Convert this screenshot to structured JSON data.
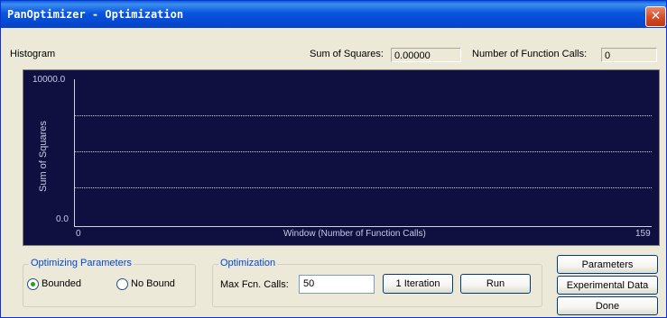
{
  "window": {
    "title": "PanOptimizer - Optimization",
    "close_glyph": "✕"
  },
  "header": {
    "histogram_label": "Histogram",
    "sum_of_squares_label": "Sum of Squares:",
    "sum_of_squares_value": "0.00000",
    "function_calls_label": "Number of Function Calls:",
    "function_calls_value": "0"
  },
  "chart_data": {
    "type": "line",
    "title": "",
    "xlabel": "Window (Number of Function Calls)",
    "ylabel": "Sum of Squares",
    "xlim": [
      0,
      159
    ],
    "ylim": [
      0.0,
      10000.0
    ],
    "x_tick_labels": [
      "0",
      "159"
    ],
    "y_tick_labels": [
      "10000.0",
      "0.0"
    ],
    "grid": true,
    "series": []
  },
  "optimizing_parameters": {
    "title": "Optimizing Parameters",
    "options": [
      {
        "label": "Bounded",
        "selected": true
      },
      {
        "label": "No Bound",
        "selected": false
      }
    ]
  },
  "optimization": {
    "title": "Optimization",
    "max_calls_label": "Max Fcn. Calls:",
    "max_calls_value": "50",
    "iteration_button": "1 Iteration",
    "run_button": "Run"
  },
  "side_buttons": {
    "parameters": "Parameters",
    "experimental_data": "Experimental Data",
    "done": "Done"
  },
  "colors": {
    "plot_background": "#101040",
    "group_title": "#0046d5"
  }
}
